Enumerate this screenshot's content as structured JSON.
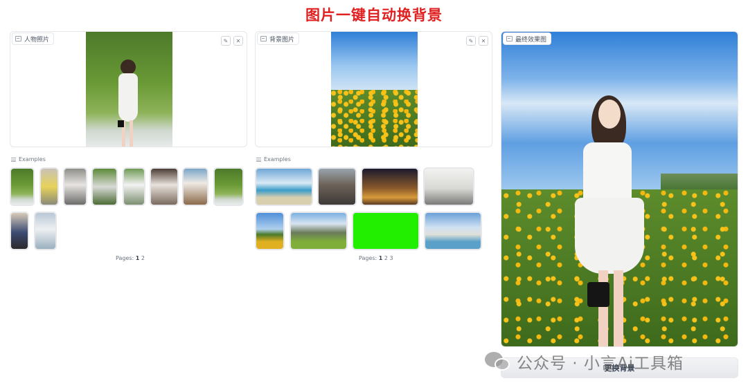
{
  "page": {
    "title": "图片一键自动换背景"
  },
  "person_panel": {
    "label": "人物照片",
    "edit_icon": "pencil-icon",
    "clear_icon": "close-icon"
  },
  "background_panel": {
    "label": "背景图片",
    "edit_icon": "pencil-icon",
    "clear_icon": "close-icon"
  },
  "result_panel": {
    "label": "最终效果图"
  },
  "person_examples": {
    "header": "Examples",
    "pages_label": "Pages:",
    "pages": [
      "1",
      "2"
    ],
    "current_page": "1"
  },
  "background_examples": {
    "header": "Examples",
    "pages_label": "Pages:",
    "pages": [
      "1",
      "2",
      "3"
    ],
    "current_page": "1"
  },
  "action": {
    "label": "更换背景"
  },
  "watermark": {
    "text": "公众号 · 小言Ai工具箱"
  },
  "colors": {
    "title": "#e02020",
    "green_screen": "#22ee00"
  }
}
